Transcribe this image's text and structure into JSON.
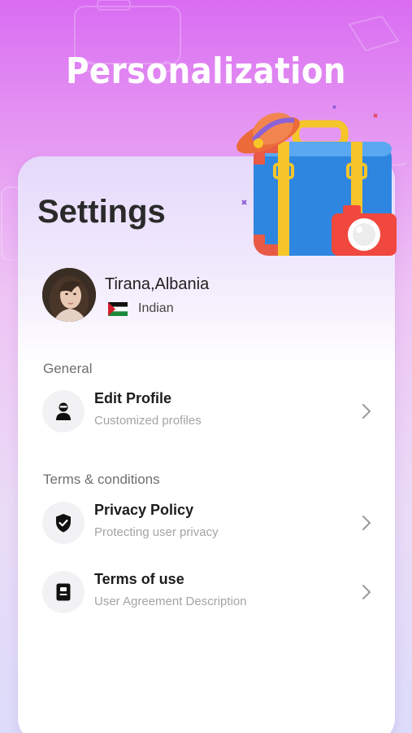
{
  "hero": {
    "title": "Personalization"
  },
  "settings": {
    "title": "Settings",
    "profile": {
      "location": "Tirana,Albania",
      "nationality": "Indian",
      "flag_icon": "flag-icon"
    }
  },
  "sections": [
    {
      "label": "General"
    },
    {
      "label": "Terms & conditions"
    }
  ],
  "menu": [
    {
      "icon": "user-icon",
      "title": "Edit Profile",
      "subtitle": "Customized profiles"
    },
    {
      "icon": "shield-check-icon",
      "title": "Privacy Policy",
      "subtitle": "Protecting user privacy"
    },
    {
      "icon": "document-icon",
      "title": "Terms of use",
      "subtitle": "User Agreement Description"
    }
  ],
  "colors": {
    "accent": "#d96cf2",
    "text_primary": "#1c1c1c",
    "text_secondary": "#a4a4a4",
    "icon_bg": "#f2f2f4"
  }
}
